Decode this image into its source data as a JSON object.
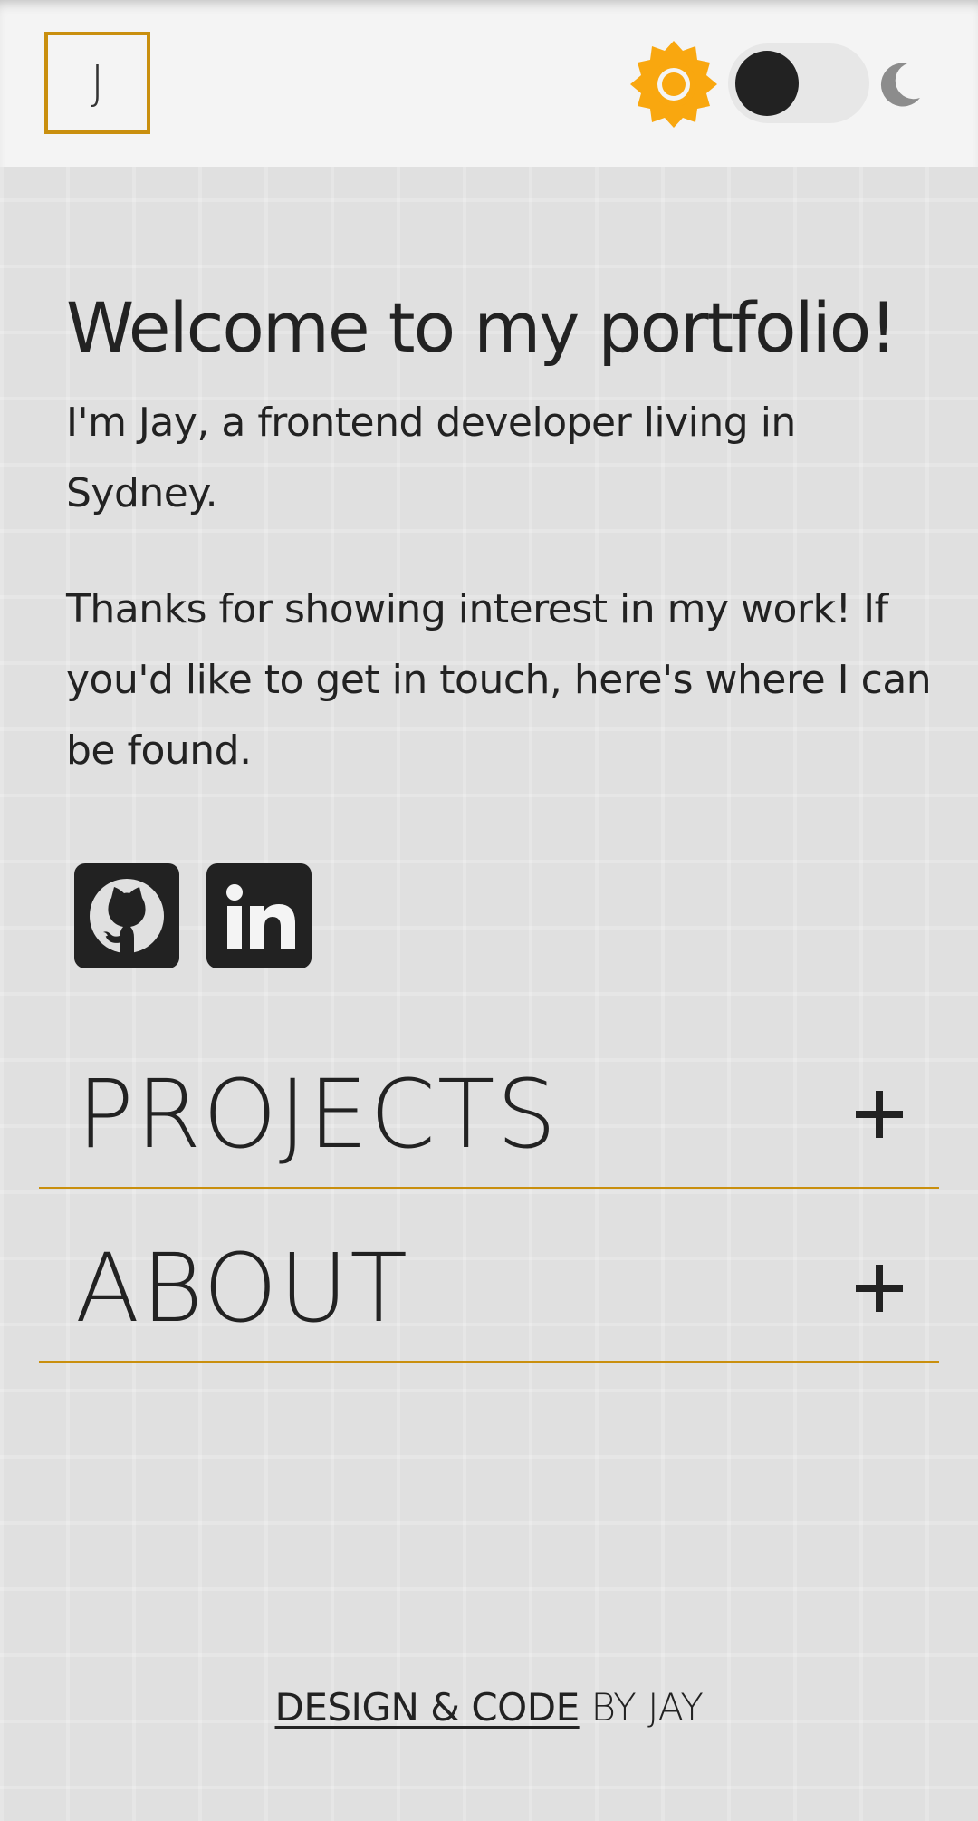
{
  "header": {
    "logo_text": "J",
    "theme_toggle": {
      "light_icon": "sun-icon",
      "dark_icon": "moon-icon",
      "state": "light"
    }
  },
  "intro": {
    "heading": "Welcome to my portfolio!",
    "paragraph_1": "I'm Jay, a frontend developer living in Sydney.",
    "paragraph_2": "Thanks for showing interest in my work! If you'd like to get in touch, here's where I can be found."
  },
  "socials": [
    {
      "icon": "github-icon"
    },
    {
      "icon": "linkedin-icon"
    }
  ],
  "accordion": [
    {
      "title": "PROJECTS",
      "icon": "plus-icon"
    },
    {
      "title": "ABOUT",
      "icon": "plus-icon"
    }
  ],
  "footer": {
    "link_text": "DESIGN & CODE",
    "suffix_text": " BY JAY"
  },
  "colors": {
    "accent": "#c98f0e",
    "sun": "#f9a70f",
    "text": "#222222",
    "background": "#e0e0e0",
    "header_bg": "#f4f4f4"
  }
}
